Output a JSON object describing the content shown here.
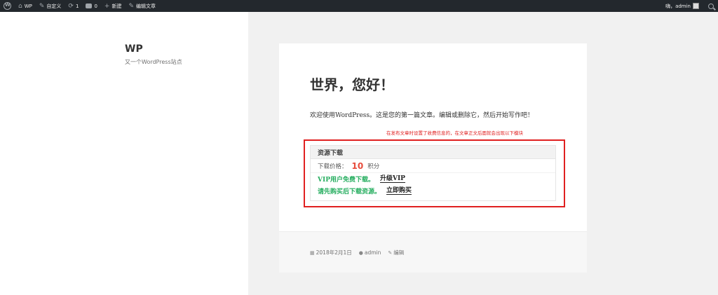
{
  "adminbar": {
    "site": "WP",
    "customize": "自定义",
    "updates_count": "1",
    "comments_count": "0",
    "new": "新建",
    "edit_post": "编辑文章",
    "greeting": "嗨，",
    "user": "admin"
  },
  "site": {
    "title": "WP",
    "description": "又一个WordPress站点"
  },
  "post": {
    "title": "世界，您好！",
    "body": "欢迎使用WordPress。这是您的第一篇文章。编辑或删除它，然后开始写作吧！",
    "annotation": "在发布文章时设置了收费信息的，在文章正文后面就会出现以下模块",
    "resource": {
      "header": "资源下载",
      "price_label": "下载价格：",
      "price_value": "10",
      "price_unit": "积分",
      "vip_text": "VIP用户免费下载。",
      "vip_link": "升级VIP",
      "buy_text": "请先购买后下载资源。",
      "buy_link": "立即购买"
    },
    "meta": {
      "date": "2018年2月1日",
      "author": "admin",
      "edit": "编辑"
    }
  },
  "colors": {
    "adminbar_bg": "#23282d",
    "annotation_red": "#e02020",
    "price_red": "#e74c3c",
    "vip_green": "#27ae60"
  }
}
